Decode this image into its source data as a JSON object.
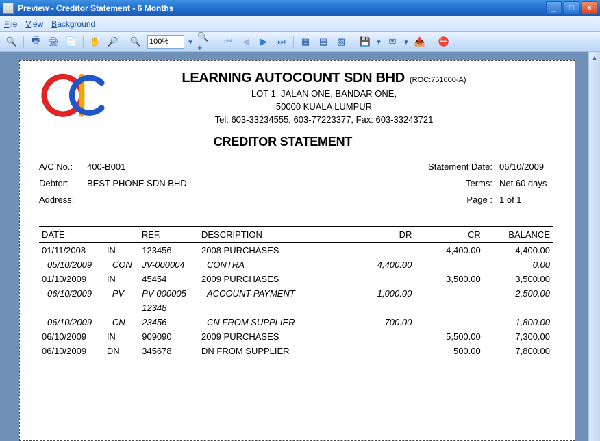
{
  "window": {
    "title": "Preview - Creditor Statement - 6 Months"
  },
  "menubar": {
    "file": "File",
    "view": "View",
    "background": "Background"
  },
  "toolbar": {
    "zoom_value": "100%"
  },
  "company": {
    "name": "LEARNING AUTOCOUNT SDN BHD",
    "roc": "(ROC:751600-A)",
    "addr1": "LOT 1, JALAN ONE,  BANDAR ONE,",
    "addr2": "50000 KUALA LUMPUR",
    "contact": "Tel: 603-33234555,  603-77223377,  Fax: 603-33243721"
  },
  "report": {
    "title": "CREDITOR STATEMENT"
  },
  "account": {
    "ac_no_label": "A/C No.:",
    "ac_no": "400-B001",
    "debtor_label": "Debtor:",
    "debtor": "BEST PHONE SDN BHD",
    "address_label": "Address:",
    "statement_date_label": "Statement Date:",
    "statement_date": "06/10/2009",
    "terms_label": "Terms:",
    "terms": "Net 60 days",
    "page_label": "Page :",
    "page": "1 of 1"
  },
  "table": {
    "headers": {
      "date": "DATE",
      "ref": "REF.",
      "desc": "DESCRIPTION",
      "dr": "DR",
      "cr": "CR",
      "bal": "BALANCE"
    },
    "rows": [
      {
        "date": "01/11/2008",
        "type": "IN",
        "ref": "123456",
        "desc": "2008 PURCHASES",
        "dr": "",
        "cr": "4,400.00",
        "bal": "4,400.00",
        "italic": false,
        "indent": false
      },
      {
        "date": "05/10/2009",
        "type": "CON",
        "ref": "JV-000004",
        "desc": "CONTRA",
        "dr": "4,400.00",
        "cr": "",
        "bal": "0.00",
        "italic": true,
        "indent": true
      },
      {
        "date": "01/10/2009",
        "type": "IN",
        "ref": "45454",
        "desc": "2009 PURCHASES",
        "dr": "",
        "cr": "3,500.00",
        "bal": "3,500.00",
        "italic": false,
        "indent": false
      },
      {
        "date": "06/10/2009",
        "type": "PV",
        "ref": "PV-000005",
        "desc": "ACCOUNT PAYMENT",
        "dr": "1,000.00",
        "cr": "",
        "bal": "2,500.00",
        "italic": true,
        "indent": true
      },
      {
        "date": "",
        "type": "",
        "ref": "12348",
        "desc": "",
        "dr": "",
        "cr": "",
        "bal": "",
        "italic": true,
        "indent": true
      },
      {
        "date": "06/10/2009",
        "type": "CN",
        "ref": "23456",
        "desc": "CN FROM SUPPLIER",
        "dr": "700.00",
        "cr": "",
        "bal": "1,800.00",
        "italic": true,
        "indent": true
      },
      {
        "date": "06/10/2009",
        "type": "IN",
        "ref": "909090",
        "desc": "2009 PURCHASES",
        "dr": "",
        "cr": "5,500.00",
        "bal": "7,300.00",
        "italic": false,
        "indent": false
      },
      {
        "date": "06/10/2009",
        "type": "DN",
        "ref": "345678",
        "desc": "DN FROM SUPPLIER",
        "dr": "",
        "cr": "500.00",
        "bal": "7,800.00",
        "italic": false,
        "indent": false
      }
    ]
  }
}
